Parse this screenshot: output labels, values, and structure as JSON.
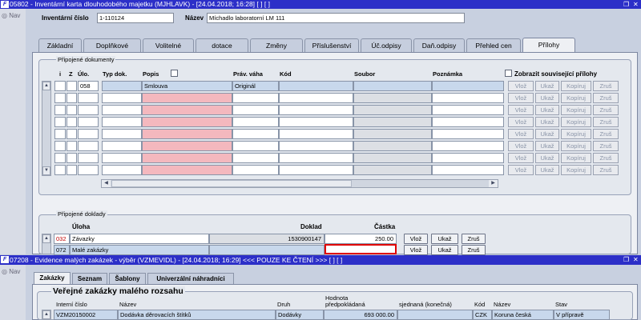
{
  "window1": {
    "title": "05802 - Inventární karta dlouhodobého majetku (MJHLAVK) - [24.04.2018; 16:28]  [ ]  [ ]",
    "nav_label": "Nav",
    "inv_label": "Inventární číslo",
    "inv_value": "1-110124",
    "name_label": "Název",
    "name_value": "Míchadlo laboratorní LM 111",
    "tabs": [
      "Základní",
      "Doplňkové",
      "Volitelné",
      "dotace",
      "Změny",
      "Příslušenství",
      "Úč.odpisy",
      "Daň.odpisy",
      "Přehled cen",
      "Přílohy"
    ],
    "attached_docs": {
      "title": "Připojené dokumenty",
      "headers": [
        "i",
        "Z",
        "Úlo.",
        "Typ dok.",
        "Popis",
        "Práv. váha",
        "Kód",
        "Soubor",
        "Poznámka"
      ],
      "show_related": "Zobrazit související přílohy",
      "row1": {
        "ulo": "058",
        "typ": "",
        "popis": "Smlouva",
        "vaha": "Originál",
        "kod": "",
        "soubor": "",
        "poznamka": ""
      },
      "row_buttons": [
        "Vlož",
        "Ukaž",
        "Kopíruj",
        "Zruš"
      ]
    },
    "attached_records": {
      "title": "Připojené doklady",
      "headers": {
        "uloha": "Úloha",
        "doklad": "Doklad",
        "castka": "Částka"
      },
      "rows": [
        {
          "code": "032",
          "name": "Závazky",
          "doklad": "1530900147",
          "castka": "250.00"
        },
        {
          "code": "072",
          "name": "Malé zakázky",
          "doklad": "",
          "castka": ""
        }
      ],
      "buttons": [
        "Vlož",
        "Ukaž",
        "Zruš"
      ]
    }
  },
  "window2": {
    "title": "07208 - Evidence malých zakázek - výběr (VZMEVIDL) - [24.04.2018; 16:29] <<< POUZE KE ČTENÍ >>>  [ ]  [ ]",
    "nav_label": "Nav",
    "tabs": [
      "Zakázky",
      "Seznam",
      "Šablony",
      "Univerzální náhradníci"
    ],
    "section_title": "Veřejné zakázky malého rozsahu",
    "headers": {
      "interni": "Interní číslo",
      "nazev": "Název",
      "druh": "Druh",
      "hodnota": "Hodnota",
      "predpokladana": "předpokládaná",
      "sjednana": "sjednaná (konečná)",
      "kod": "Kód",
      "nazev2": "Název",
      "stav": "Stav"
    },
    "row": {
      "interni": "VZM20150002",
      "nazev": "Dodávka děrovacích štítků",
      "druh": "Dodávky",
      "predpokladana": "693 000.00",
      "sjednana": "",
      "kod": "CZK",
      "mena": "Koruna česká",
      "stav": "V přípravě"
    }
  },
  "colors": {
    "titlebar": "#2c2fc8",
    "highlight_box": "#e00000",
    "pink_cell": "#f4b8be"
  }
}
